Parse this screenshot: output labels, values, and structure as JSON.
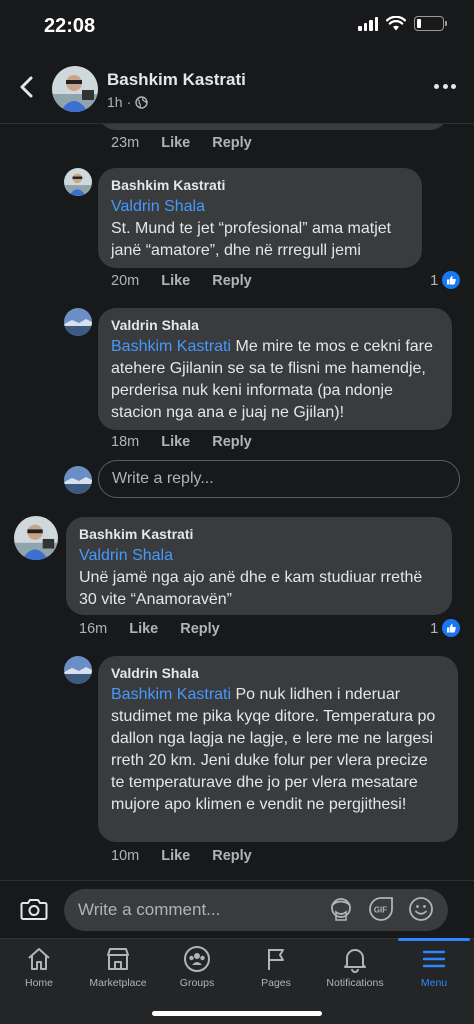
{
  "status_bar": {
    "time": "22:08",
    "battery_fraction": 0.18
  },
  "header": {
    "name": "Bashkim Kastrati",
    "time": "1h",
    "separator": "·"
  },
  "top_actions": {
    "time": "23m",
    "like": "Like",
    "reply": "Reply"
  },
  "comments": [
    {
      "author": "Bashkim Kastrati",
      "mention": "Valdrin Shala",
      "text": "St. Mund te jet “profesional” ama matjet janë “amatore”, dhe në rrregull jemi",
      "time": "20m",
      "like": "Like",
      "reply": "Reply",
      "likes": "1"
    },
    {
      "author": "Valdrin Shala",
      "mention": "Bashkim Kastrati",
      "text": "Me mire te mos e cekni fare atehere Gjilanin se sa te flisni me hamendje, perderisa nuk keni informata (pa ndonje stacion nga ana e juaj ne Gjilan)!",
      "time": "18m",
      "like": "Like",
      "reply": "Reply"
    },
    {
      "author": "Bashkim Kastrati",
      "mention": "Valdrin Shala",
      "text": "Unë jamë nga ajo anë dhe e kam studiuar rrethë 30 vite “Anamoravën”",
      "time": "16m",
      "like": "Like",
      "reply": "Reply",
      "likes": "1"
    },
    {
      "author": "Valdrin Shala",
      "mention": "Bashkim Kastrati",
      "text": "Po nuk lidhen i nderuar studimet me pika kyqe ditore. Temperatura po dallon nga lagja ne lagje, e lere me ne largesi rreth 20 km. Jeni duke folur per vlera precize te temperaturave dhe jo per vlera mesatare mujore apo klimen e vendit ne pergjithesi!",
      "time": "10m",
      "like": "Like",
      "reply": "Reply"
    }
  ],
  "reply_box": {
    "placeholder": "Write a reply..."
  },
  "composer": {
    "placeholder": "Write a comment..."
  },
  "tabs": [
    {
      "label": "Home",
      "icon": "home-icon"
    },
    {
      "label": "Marketplace",
      "icon": "marketplace-icon"
    },
    {
      "label": "Groups",
      "icon": "groups-icon"
    },
    {
      "label": "Pages",
      "icon": "pages-icon"
    },
    {
      "label": "Notifications",
      "icon": "bell-icon"
    },
    {
      "label": "Menu",
      "icon": "menu-icon",
      "active": true
    }
  ],
  "colors": {
    "background": "#18191a",
    "bubble": "#3a3b3c",
    "mention": "#4599ff",
    "accent": "#2d88ff",
    "like": "#1877f2"
  }
}
